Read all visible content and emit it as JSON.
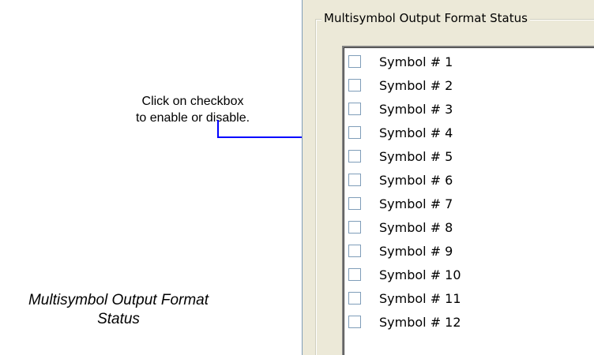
{
  "callout": {
    "line1": "Click on checkbox",
    "line2": "to enable or disable."
  },
  "caption": {
    "line1": "Multisymbol Output Format",
    "line2": "Status"
  },
  "group": {
    "title": "Multisymbol Output Format Status"
  },
  "symbols": [
    {
      "label": "Symbol # 1",
      "checked": false
    },
    {
      "label": "Symbol # 2",
      "checked": false
    },
    {
      "label": "Symbol # 3",
      "checked": false
    },
    {
      "label": "Symbol # 4",
      "checked": false
    },
    {
      "label": "Symbol # 5",
      "checked": false
    },
    {
      "label": "Symbol # 6",
      "checked": false
    },
    {
      "label": "Symbol # 7",
      "checked": false
    },
    {
      "label": "Symbol # 8",
      "checked": false
    },
    {
      "label": "Symbol # 9",
      "checked": false
    },
    {
      "label": "Symbol # 10",
      "checked": false
    },
    {
      "label": "Symbol # 11",
      "checked": false
    },
    {
      "label": "Symbol # 12",
      "checked": false
    }
  ],
  "colors": {
    "arrow": "#0000ff",
    "panel_background": "#ece9d8",
    "checkbox_border": "#7f9db9"
  }
}
